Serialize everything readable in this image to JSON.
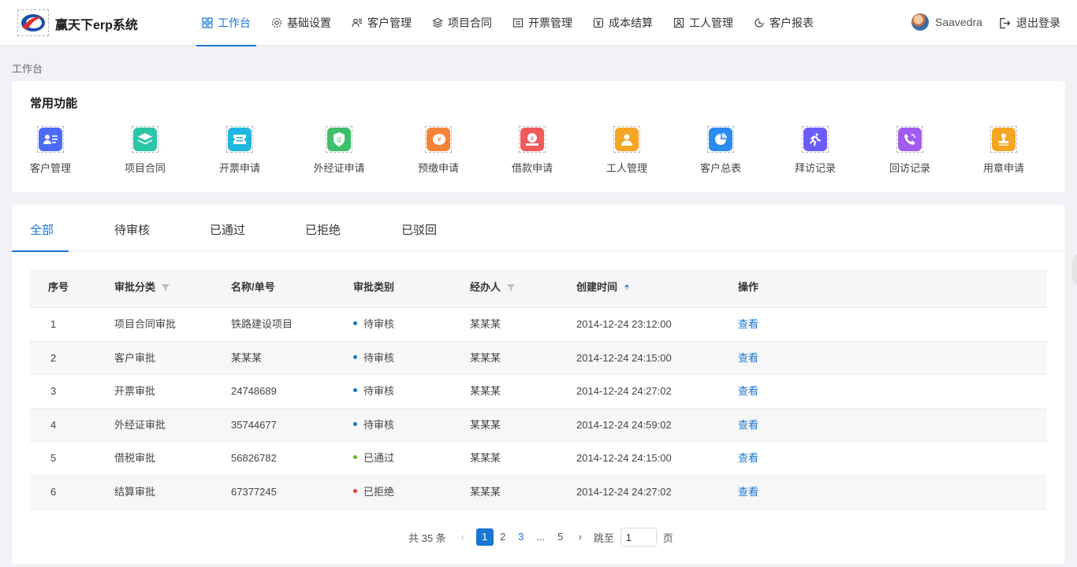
{
  "header": {
    "app_title": "赢天下erp系统",
    "nav": [
      {
        "label": "工作台",
        "icon": "dashboard-icon",
        "active": true
      },
      {
        "label": "基础设置",
        "icon": "settings-icon",
        "active": false
      },
      {
        "label": "客户管理",
        "icon": "customers-icon",
        "active": false
      },
      {
        "label": "项目合同",
        "icon": "layers-icon",
        "active": false
      },
      {
        "label": "开票管理",
        "icon": "invoice-icon",
        "active": false
      },
      {
        "label": "成本结算",
        "icon": "yen-icon",
        "active": false
      },
      {
        "label": "工人管理",
        "icon": "worker-icon",
        "active": false
      },
      {
        "label": "客户报表",
        "icon": "clock-icon",
        "active": false
      }
    ],
    "user_name": "Saavedra",
    "logout_label": "退出登录"
  },
  "breadcrumb": "工作台",
  "common": {
    "title": "常用功能",
    "items": [
      {
        "label": "客户管理",
        "icon": "customer-card-icon",
        "color": "#4a6cf7"
      },
      {
        "label": "项目合同",
        "icon": "layers-icon",
        "color": "#2bc5a8"
      },
      {
        "label": "开票申请",
        "icon": "ticket-icon",
        "color": "#1fb6e0"
      },
      {
        "label": "外经证申请",
        "icon": "certificate-icon",
        "color": "#3fbf6a"
      },
      {
        "label": "预缴申请",
        "icon": "yen-coin-icon",
        "color": "#f5843a"
      },
      {
        "label": "借款申请",
        "icon": "loan-icon",
        "color": "#f05a5a"
      },
      {
        "label": "工人管理",
        "icon": "worker-icon",
        "color": "#f5a623"
      },
      {
        "label": "客户总表",
        "icon": "pie-chart-icon",
        "color": "#2e8cf0"
      },
      {
        "label": "拜访记录",
        "icon": "running-man-icon",
        "color": "#6a5cf5"
      },
      {
        "label": "回访记录",
        "icon": "phone-icon",
        "color": "#a25cf0"
      },
      {
        "label": "用章申请",
        "icon": "stamp-icon",
        "color": "#f5a623"
      }
    ]
  },
  "tabs": [
    "全部",
    "待审核",
    "已通过",
    "已拒绝",
    "已驳回"
  ],
  "table": {
    "columns": [
      "序号",
      "审批分类",
      "名称/单号",
      "审批类别",
      "经办人",
      "创建时间",
      "操作"
    ],
    "rows": [
      {
        "no": "1",
        "category": "项目合同审批",
        "name": "铁路建设项目",
        "status": "待审核",
        "status_color": "#1976d2",
        "handler": "某某某",
        "time": "2014-12-24  23:12:00",
        "action": "查看"
      },
      {
        "no": "2",
        "category": "客户审批",
        "name": "某某某",
        "status": "待审核",
        "status_color": "#1976d2",
        "handler": "某某某",
        "time": "2014-12-24  24:15:00",
        "action": "查看"
      },
      {
        "no": "3",
        "category": "开票审批",
        "name": "24748689",
        "status": "待审核",
        "status_color": "#1976d2",
        "handler": "某某某",
        "time": "2014-12-24  24:27:02",
        "action": "查看"
      },
      {
        "no": "4",
        "category": "外经证审批",
        "name": "35744677",
        "status": "待审核",
        "status_color": "#1976d2",
        "handler": "某某某",
        "time": "2014-12-24  24:59:02",
        "action": "查看"
      },
      {
        "no": "5",
        "category": "借税审批",
        "name": "56826782",
        "status": "已通过",
        "status_color": "#52c41a",
        "handler": "某某某",
        "time": "2014-12-24  24:15:00",
        "action": "查看"
      },
      {
        "no": "6",
        "category": "结算审批",
        "name": "67377245",
        "status": "已拒绝",
        "status_color": "#e53935",
        "handler": "某某某",
        "time": "2014-12-24  24:27:02",
        "action": "查看"
      }
    ]
  },
  "pagination": {
    "total": "共 35 条",
    "pages": [
      "1",
      "2",
      "3",
      "...",
      "5"
    ],
    "jump_label": "跳至",
    "jump_value": "1",
    "page_unit": "页"
  }
}
